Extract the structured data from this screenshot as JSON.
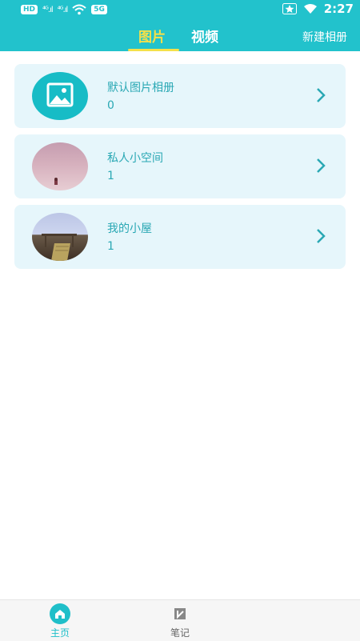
{
  "status": {
    "left_badges": [
      "HD",
      "5G"
    ],
    "signal_1": "⁴ᴳ.ıl",
    "signal_2": "⁴ᴳ.ıl",
    "time": "2:27"
  },
  "header": {
    "tabs": [
      {
        "label": "图片",
        "active": true
      },
      {
        "label": "视频",
        "active": false
      }
    ],
    "new_album": "新建相册"
  },
  "albums": [
    {
      "title": "默认图片相册",
      "count": "0",
      "thumb": "image-icon"
    },
    {
      "title": "私人小空间",
      "count": "1",
      "thumb": "pink-photo"
    },
    {
      "title": "我的小屋",
      "count": "1",
      "thumb": "house-photo"
    }
  ],
  "bottom_nav": [
    {
      "label": "主页",
      "icon": "home-icon",
      "active": true
    },
    {
      "label": "笔记",
      "icon": "note-icon",
      "active": false
    }
  ],
  "colors": {
    "accent": "#22c2cc",
    "tab_active": "#f4e04a",
    "card_bg": "#e6f6fb",
    "text_teal": "#2aa8b4"
  }
}
